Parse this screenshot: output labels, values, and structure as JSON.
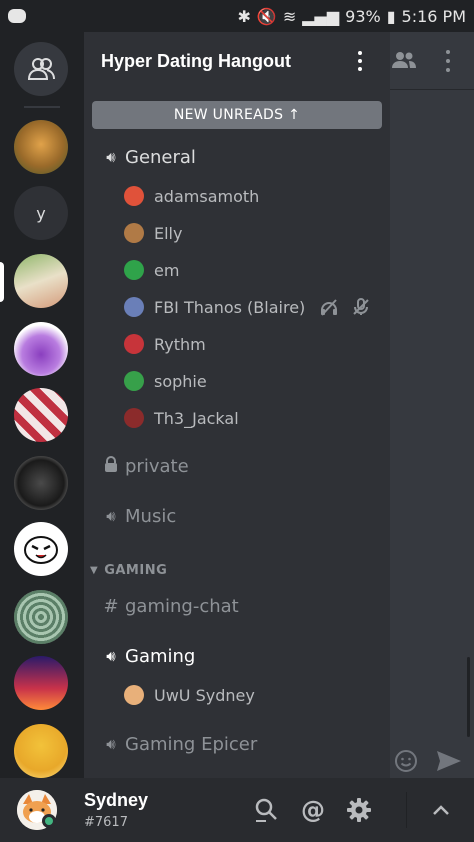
{
  "status_bar": {
    "battery": "93%",
    "time": "5:16 PM"
  },
  "server": {
    "name": "Hyper Dating Hangout",
    "new_unreads": "NEW UNREADS ↑"
  },
  "rail": {
    "letter_server": "y"
  },
  "channels": {
    "general": "General",
    "general_users": [
      {
        "name": "adamsamoth",
        "color": "#e0523a"
      },
      {
        "name": "Elly",
        "color": "#b07a46"
      },
      {
        "name": "em",
        "color": "#2fa34a"
      },
      {
        "name": "FBI Thanos (Blaire)",
        "color": "#6a7fb8"
      },
      {
        "name": "Rythm",
        "color": "#c7343a"
      },
      {
        "name": "sophie",
        "color": "#37a04a"
      },
      {
        "name": "Th3_Jackal",
        "color": "#8b2b2b"
      }
    ],
    "private": "private",
    "music": "Music",
    "category_gaming": "GAMING",
    "gaming_chat": "gaming-chat",
    "gaming": "Gaming",
    "gaming_users": [
      {
        "name": "UwU Sydney",
        "color": "#e8b07a"
      }
    ],
    "gaming_epicer": "Gaming Epicer"
  },
  "user": {
    "name": "Sydney",
    "tag": "#7617",
    "status_color": "#43b581"
  },
  "icons": {
    "home": "friends-icon",
    "search": "search-icon",
    "mention": "mention-icon",
    "settings": "gear-icon"
  }
}
